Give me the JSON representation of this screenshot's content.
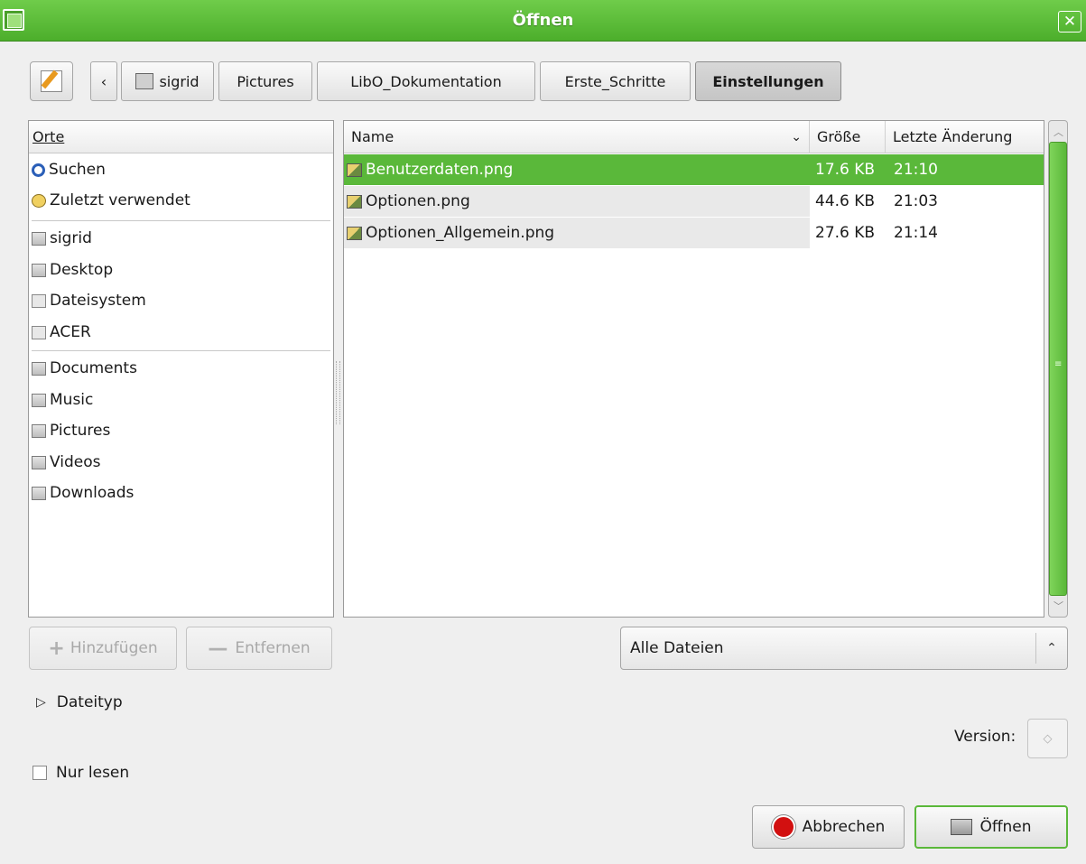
{
  "window": {
    "title": "Öffnen"
  },
  "pathbar": {
    "back": "‹",
    "crumbs": [
      "sigrid",
      "Pictures",
      "LibO_Dokumentation",
      "Erste_Schritte",
      "Einstellungen"
    ]
  },
  "places": {
    "header": "Orte",
    "items": [
      {
        "label": "Suchen",
        "icon": "search-icon"
      },
      {
        "label": "Zuletzt verwendet",
        "icon": "recent-icon"
      },
      {
        "label": "sigrid",
        "icon": "home-folder-icon"
      },
      {
        "label": "Desktop",
        "icon": "desktop-folder-icon"
      },
      {
        "label": "Dateisystem",
        "icon": "drive-icon"
      },
      {
        "label": "ACER",
        "icon": "drive-icon"
      },
      {
        "label": "Documents",
        "icon": "documents-folder-icon"
      },
      {
        "label": "Music",
        "icon": "music-folder-icon"
      },
      {
        "label": "Pictures",
        "icon": "pictures-folder-icon"
      },
      {
        "label": "Videos",
        "icon": "videos-folder-icon"
      },
      {
        "label": "Downloads",
        "icon": "downloads-folder-icon"
      }
    ],
    "add": "Hinzufügen",
    "remove": "Entfernen"
  },
  "files": {
    "columns": {
      "name": "Name",
      "size": "Größe",
      "modified": "Letzte Änderung"
    },
    "rows": [
      {
        "name": "Benutzerdaten.png",
        "size": "17.6 KB",
        "modified": "21:10",
        "selected": true
      },
      {
        "name": "Optionen.png",
        "size": "44.6 KB",
        "modified": "21:03",
        "selected": false
      },
      {
        "name": "Optionen_Allgemein.png",
        "size": "27.6 KB",
        "modified": "21:14",
        "selected": false
      }
    ]
  },
  "filter": {
    "value": "Alle Dateien"
  },
  "filetype": {
    "label": "Dateityp"
  },
  "version": {
    "label": "Version:"
  },
  "readonly": {
    "label": "Nur lesen",
    "checked": false
  },
  "actions": {
    "cancel": "Abbrechen",
    "open": "Öffnen"
  },
  "colors": {
    "accent": "#5ab83a",
    "titlebar": "#5cbd37"
  }
}
